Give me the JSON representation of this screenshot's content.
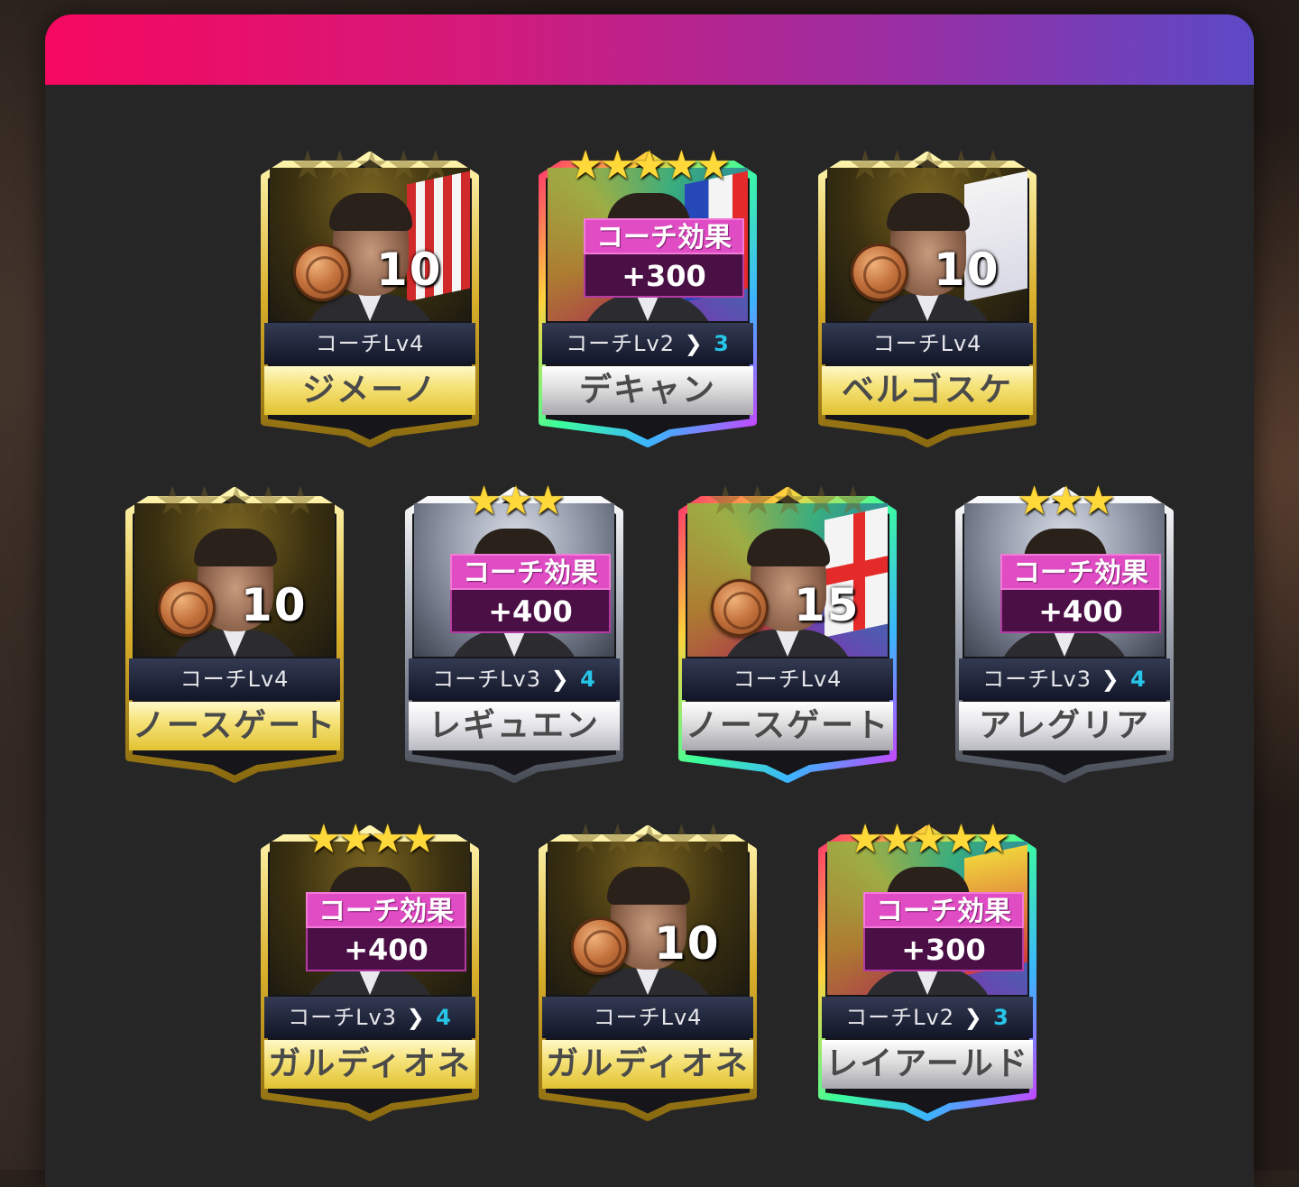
{
  "panel": {
    "header_colors": [
      "#f5085f",
      "#5c49c6"
    ]
  },
  "cards": [
    {
      "id": "c1",
      "tier": "gold",
      "stars_lit": 0,
      "stars_total": 5,
      "name": "ジメーノ",
      "coach_level": "コーチLv4",
      "next_level": "",
      "effect": null,
      "medal_level": "10"
    },
    {
      "id": "c2",
      "tier": "rainbow",
      "stars_lit": 5,
      "stars_total": 5,
      "name": "デキャン",
      "coach_level": "コーチLv2",
      "next_level": "3",
      "effect": {
        "label": "コーチ効果",
        "value": "+300"
      },
      "medal_level": null
    },
    {
      "id": "c3",
      "tier": "gold",
      "stars_lit": 0,
      "stars_total": 5,
      "name": "ベルゴスケ",
      "coach_level": "コーチLv4",
      "next_level": "",
      "effect": null,
      "medal_level": "10"
    },
    {
      "id": "c4",
      "tier": "gold",
      "stars_lit": 0,
      "stars_total": 5,
      "name": "ノースゲート",
      "coach_level": "コーチLv4",
      "next_level": "",
      "effect": null,
      "medal_level": "10"
    },
    {
      "id": "c5",
      "tier": "silver",
      "stars_lit": 3,
      "stars_total": 3,
      "name": "レギュエン",
      "coach_level": "コーチLv3",
      "next_level": "4",
      "effect": {
        "label": "コーチ効果",
        "value": "+400"
      },
      "medal_level": null
    },
    {
      "id": "c6",
      "tier": "rainbow",
      "stars_lit": 0,
      "stars_total": 5,
      "name": "ノースゲート",
      "coach_level": "コーチLv4",
      "next_level": "",
      "effect": null,
      "medal_level": "15"
    },
    {
      "id": "c7",
      "tier": "silver",
      "stars_lit": 3,
      "stars_total": 3,
      "name": "アレグリア",
      "coach_level": "コーチLv3",
      "next_level": "4",
      "effect": {
        "label": "コーチ効果",
        "value": "+400"
      },
      "medal_level": null
    },
    {
      "id": "c8",
      "tier": "gold",
      "stars_lit": 4,
      "stars_total": 4,
      "name": "ガルディオネ",
      "coach_level": "コーチLv3",
      "next_level": "4",
      "effect": {
        "label": "コーチ効果",
        "value": "+400"
      },
      "medal_level": null
    },
    {
      "id": "c9",
      "tier": "gold",
      "stars_lit": 0,
      "stars_total": 5,
      "name": "ガルディオネ",
      "coach_level": "コーチLv4",
      "next_level": "",
      "effect": null,
      "medal_level": "10"
    },
    {
      "id": "c10",
      "tier": "rainbow",
      "stars_lit": 5,
      "stars_total": 5,
      "name": "レイアールド",
      "coach_level": "コーチLv2",
      "next_level": "3",
      "effect": {
        "label": "コーチ効果",
        "value": "+300"
      },
      "medal_level": null
    }
  ],
  "colors": {
    "gold": "#e2c233",
    "silver": "#b8b8c0",
    "effect_label": "#e04cc4",
    "effect_value": "#4a0f44",
    "next_level": "#27c5e8"
  }
}
